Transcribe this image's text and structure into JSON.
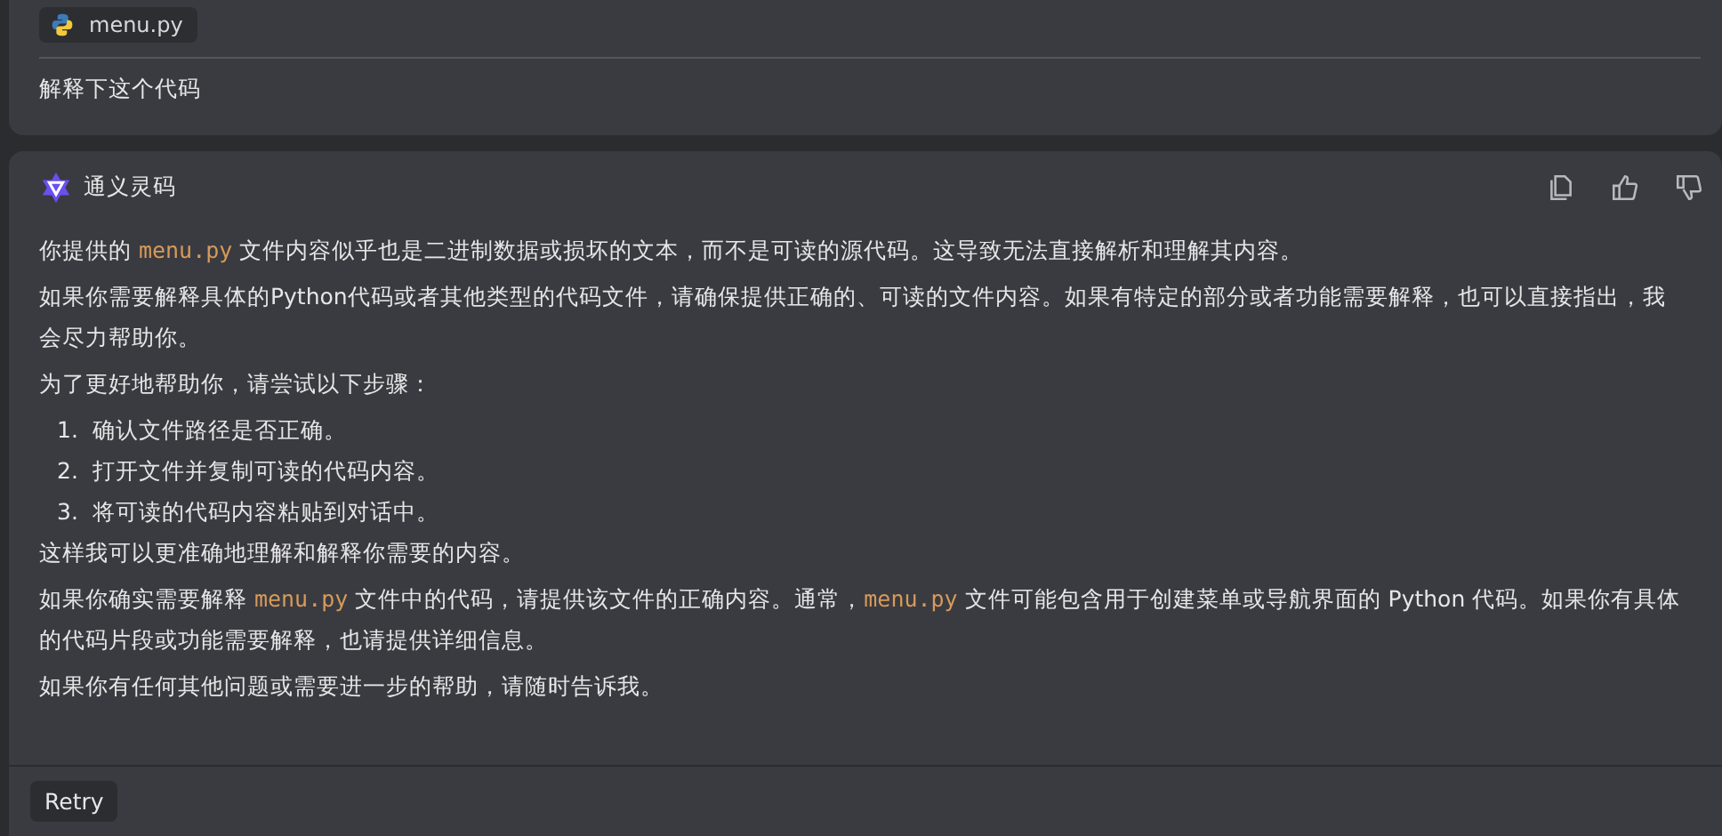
{
  "user_message": {
    "attachment": {
      "filename": "menu.py"
    },
    "text": "解释下这个代码"
  },
  "reply": {
    "assistant_name": "通义灵码",
    "paragraphs": [
      {
        "segments": [
          {
            "kind": "text",
            "text": "你提供的 "
          },
          {
            "kind": "code",
            "text": "menu.py"
          },
          {
            "kind": "text",
            "text": " 文件内容似乎也是二进制数据或损坏的文本，而不是可读的源代码。这导致无法直接解析和理解其内容。"
          }
        ]
      },
      {
        "segments": [
          {
            "kind": "text",
            "text": "如果你需要解释具体的Python代码或者其他类型的代码文件，请确保提供正确的、可读的文件内容。如果有特定的部分或者功能需要解释，也可以直接指出，我会尽力帮助你。"
          }
        ]
      },
      {
        "segments": [
          {
            "kind": "text",
            "text": "为了更好地帮助你，请尝试以下步骤："
          }
        ]
      }
    ],
    "steps": [
      {
        "number": "1.",
        "text": "确认文件路径是否正确。"
      },
      {
        "number": "2.",
        "text": "打开文件并复制可读的代码内容。"
      },
      {
        "number": "3.",
        "text": "将可读的代码内容粘贴到对话中。"
      }
    ],
    "closing_paragraphs": [
      {
        "segments": [
          {
            "kind": "text",
            "text": "这样我可以更准确地理解和解释你需要的内容。"
          }
        ]
      },
      {
        "segments": [
          {
            "kind": "text",
            "text": "如果你确实需要解释 "
          },
          {
            "kind": "code",
            "text": "menu.py"
          },
          {
            "kind": "text",
            "text": " 文件中的代码，请提供该文件的正确内容。通常，"
          },
          {
            "kind": "code",
            "text": "menu.py"
          },
          {
            "kind": "text",
            "text": " 文件可能包含用于创建菜单或导航界面的 Python 代码。如果你有具体的代码片段或功能需要解释，也请提供详细信息。"
          }
        ]
      },
      {
        "segments": [
          {
            "kind": "text",
            "text": "如果你有任何其他问题或需要进一步的帮助，请随时告诉我。"
          }
        ]
      }
    ]
  },
  "retry_button": {
    "label": "Retry"
  }
}
